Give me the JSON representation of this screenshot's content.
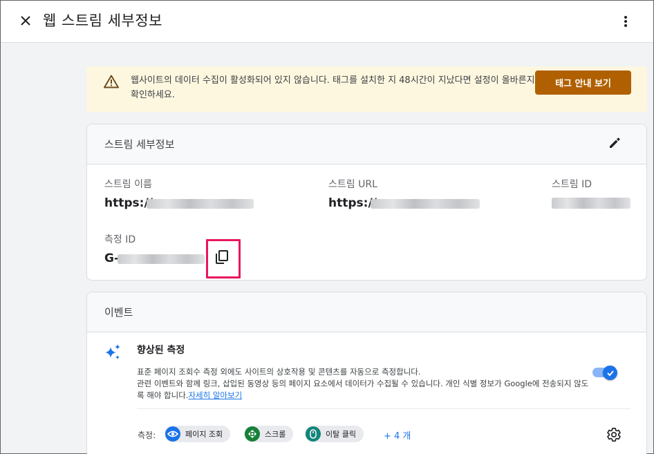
{
  "header": {
    "title": "웹 스트림 세부정보"
  },
  "banner": {
    "message": "웹사이트의 데이터 수집이 활성화되어 있지 않습니다. 태그를 설치한 지 48시간이 지났다면 설정이 올바른지 확인하세요.",
    "button_label": "태그 안내 보기",
    "accent_color": "#b06000",
    "background_color": "#fef7e0"
  },
  "stream_details": {
    "title": "스트림 세부정보",
    "stream_name_label": "스트림 이름",
    "stream_name_value": "https://",
    "stream_url_label": "스트림 URL",
    "stream_url_value": "https://",
    "stream_id_label": "스트림 ID",
    "measurement_id_label": "측정 ID",
    "measurement_id_value": "G-",
    "highlight_color": "#e8175d"
  },
  "events": {
    "title": "이벤트",
    "enhanced_title": "향상된 측정",
    "enhanced_desc_line1": "표준 페이지 조회수 측정 외에도 사이트의 상호작용 및 콘텐츠를 자동으로 측정합니다.",
    "enhanced_desc_line2": "관련 이벤트와 함께 링크, 삽입된 동영상 등의 페이지 요소에서 데이터가 수집될 수 있습니다. 개인 식별 정보가 Google에 전송되지 않도록 해야 합니다.",
    "learn_more": "자세히 알아보기",
    "toggle_on": true,
    "measurement_label": "측정:",
    "chips": [
      {
        "label": "페이지 조회",
        "icon": "eye-icon",
        "color": "#1a73e8"
      },
      {
        "label": "스크롤",
        "icon": "scroll-icon",
        "color": "#188038"
      },
      {
        "label": "이탈 클릭",
        "icon": "mouse-icon",
        "color": "#12857a"
      }
    ],
    "more_chips": "+ 4 개"
  }
}
